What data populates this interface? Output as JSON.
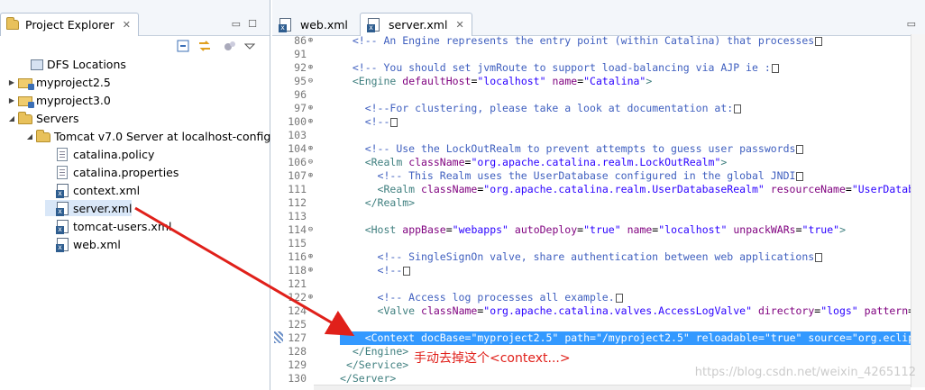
{
  "explorer": {
    "title": "Project Explorer",
    "close": "✕",
    "minimize": "▭",
    "maximize": "☐",
    "toolbar_icons": [
      "collapse-all-icon",
      "link-with-editor-icon",
      "hadoop-icon",
      "view-menu-icon"
    ],
    "tree": [
      {
        "label": "DFS Locations",
        "icon": "dfs",
        "twisty": ""
      },
      {
        "label": "myproject2.5",
        "icon": "project",
        "twisty": "▶"
      },
      {
        "label": "myproject3.0",
        "icon": "project",
        "twisty": "▶"
      },
      {
        "label": "Servers",
        "icon": "folder",
        "twisty": "◢"
      },
      {
        "label": "Tomcat v7.0 Server at localhost-config",
        "icon": "folder",
        "twisty": "◢"
      },
      {
        "label": "catalina.policy",
        "icon": "file",
        "twisty": ""
      },
      {
        "label": "catalina.properties",
        "icon": "file",
        "twisty": ""
      },
      {
        "label": "context.xml",
        "icon": "xml",
        "twisty": ""
      },
      {
        "label": "server.xml",
        "icon": "xml",
        "twisty": ""
      },
      {
        "label": "tomcat-users.xml",
        "icon": "xml",
        "twisty": ""
      },
      {
        "label": "web.xml",
        "icon": "xml",
        "twisty": ""
      }
    ]
  },
  "editor": {
    "tabs": [
      {
        "label": "web.xml",
        "active": false,
        "close": ""
      },
      {
        "label": "server.xml",
        "active": true,
        "close": "✕"
      }
    ],
    "minimize": "▭",
    "lines": [
      {
        "num": "86",
        "fold": "⊕",
        "indent": "  ",
        "text": "<!-- An Engine represents the entry point (within Catalina) that processes",
        "kind": "comment",
        "collapsed": true
      },
      {
        "num": "91",
        "fold": "",
        "indent": "",
        "text": "",
        "kind": "plain",
        "collapsed": false
      },
      {
        "num": "92",
        "fold": "⊕",
        "indent": "  ",
        "text": "<!-- You should set jvmRoute to support load-balancing via AJP ie :",
        "kind": "comment",
        "collapsed": true
      },
      {
        "num": "95",
        "fold": "⊖",
        "indent": "  ",
        "tag": "<Engine",
        "attrs": [
          [
            "defaultHost",
            "\"localhost\""
          ],
          [
            "name",
            "\"Catalina\""
          ]
        ],
        "end": ">",
        "kind": "tag"
      },
      {
        "num": "96",
        "fold": "",
        "indent": "",
        "text": "",
        "kind": "plain",
        "collapsed": false
      },
      {
        "num": "97",
        "fold": "⊕",
        "indent": "    ",
        "text": "<!--For clustering, please take a look at documentation at:",
        "kind": "comment",
        "collapsed": true
      },
      {
        "num": "100",
        "fold": "⊕",
        "indent": "    ",
        "text": "<!--",
        "kind": "comment",
        "collapsed": true
      },
      {
        "num": "103",
        "fold": "",
        "indent": "",
        "text": "",
        "kind": "plain",
        "collapsed": false
      },
      {
        "num": "104",
        "fold": "⊕",
        "indent": "    ",
        "text": "<!-- Use the LockOutRealm to prevent attempts to guess user passwords",
        "kind": "comment",
        "collapsed": true
      },
      {
        "num": "106",
        "fold": "⊖",
        "indent": "    ",
        "tag": "<Realm",
        "attrs": [
          [
            "className",
            "\"org.apache.catalina.realm.LockOutRealm\""
          ]
        ],
        "end": ">",
        "kind": "tag"
      },
      {
        "num": "107",
        "fold": "⊕",
        "indent": "      ",
        "text": "<!-- This Realm uses the UserDatabase configured in the global JNDI",
        "kind": "comment",
        "collapsed": true
      },
      {
        "num": "111",
        "fold": "",
        "indent": "      ",
        "tag": "<Realm",
        "attrs": [
          [
            "className",
            "\"org.apache.catalina.realm.UserDatabaseRealm\""
          ],
          [
            "resourceName",
            "\"UserDatab"
          ]
        ],
        "end": "",
        "kind": "tag"
      },
      {
        "num": "112",
        "fold": "",
        "indent": "    ",
        "tag": "</Realm>",
        "attrs": [],
        "end": "",
        "kind": "tag"
      },
      {
        "num": "113",
        "fold": "",
        "indent": "",
        "text": "",
        "kind": "plain",
        "collapsed": false
      },
      {
        "num": "114",
        "fold": "⊖",
        "indent": "    ",
        "tag": "<Host",
        "attrs": [
          [
            "appBase",
            "\"webapps\""
          ],
          [
            "autoDeploy",
            "\"true\""
          ],
          [
            "name",
            "\"localhost\""
          ],
          [
            "unpackWARs",
            "\"true\""
          ]
        ],
        "end": ">",
        "kind": "tag"
      },
      {
        "num": "115",
        "fold": "",
        "indent": "",
        "text": "",
        "kind": "plain",
        "collapsed": false
      },
      {
        "num": "116",
        "fold": "⊕",
        "indent": "      ",
        "text": "<!-- SingleSignOn valve, share authentication between web applications",
        "kind": "comment",
        "collapsed": true
      },
      {
        "num": "118",
        "fold": "⊕",
        "indent": "      ",
        "text": "<!--",
        "kind": "comment",
        "collapsed": true
      },
      {
        "num": "121",
        "fold": "",
        "indent": "",
        "text": "",
        "kind": "plain",
        "collapsed": false
      },
      {
        "num": "122",
        "fold": "⊕",
        "indent": "      ",
        "text": "<!-- Access log processes all example.",
        "kind": "comment",
        "collapsed": true
      },
      {
        "num": "124",
        "fold": "",
        "indent": "      ",
        "tag": "<Valve",
        "attrs": [
          [
            "className",
            "\"org.apache.catalina.valves.AccessLogValve\""
          ],
          [
            "directory",
            "\"logs\""
          ],
          [
            "pattern",
            ""
          ]
        ],
        "end": "",
        "kind": "tag"
      },
      {
        "num": "125",
        "fold": "",
        "indent": "",
        "text": "",
        "kind": "plain",
        "collapsed": false
      },
      {
        "num": "127",
        "fold": "",
        "indent": "    ",
        "tag": "<Context",
        "attrs": [
          [
            "docBase",
            "\"myproject2.5\""
          ],
          [
            "path",
            "\"/myproject2.5\""
          ],
          [
            "reloadable",
            "\"true\""
          ],
          [
            "source",
            "\"org.eclip"
          ]
        ],
        "end": "",
        "kind": "tag",
        "selected": true
      },
      {
        "num": "128",
        "fold": "",
        "indent": "  ",
        "tag": "</Engine>",
        "attrs": [],
        "end": "",
        "kind": "tag"
      },
      {
        "num": "129",
        "fold": "",
        "indent": "",
        "tag": "</Service>",
        "attrs": [],
        "end": "",
        "kind": "tag",
        "pre": " "
      },
      {
        "num": "130",
        "fold": "",
        "indent": "",
        "tag": "</Server>",
        "attrs": [],
        "end": "",
        "kind": "tag"
      }
    ]
  },
  "annotation": "手动去掉这个<context...>",
  "watermark": "https://blog.csdn.net/weixin_4265112",
  "colors": {
    "arrow": "#e0201a",
    "selection": "#3399ff",
    "comment": "#3f5fbf",
    "tag": "#3f7f7f",
    "attr": "#7f007f",
    "value": "#2a00ff"
  }
}
